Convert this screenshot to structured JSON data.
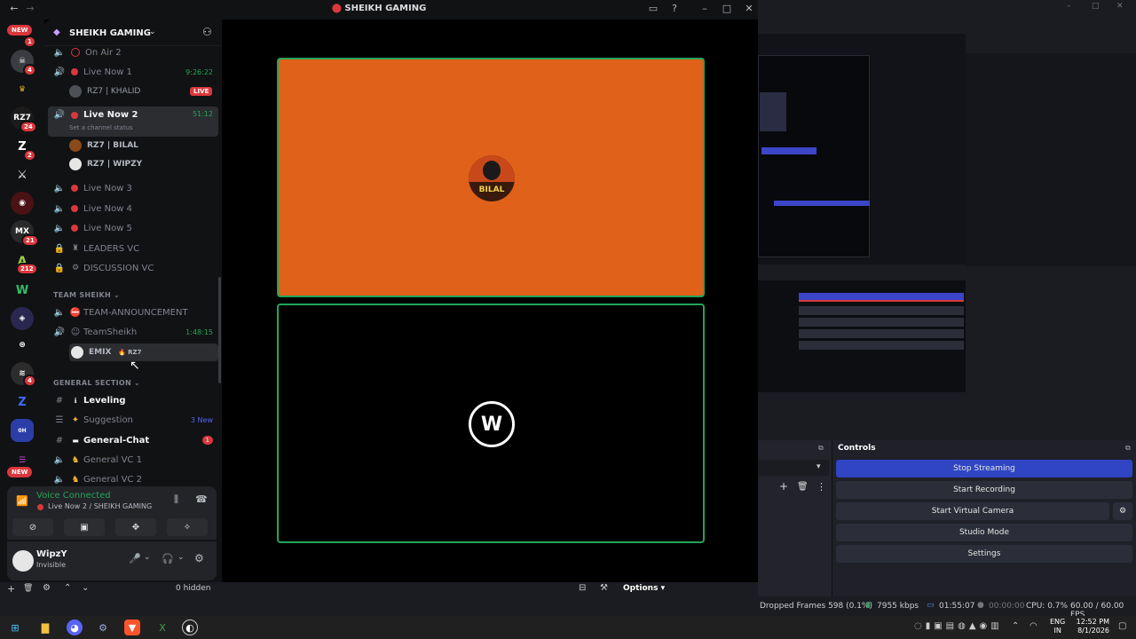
{
  "discord": {
    "window_title": "SHEIKH GAMING",
    "server_name": "SHEIKH GAMING",
    "rail_badges": {
      "new_top": "NEW",
      "b1": "1",
      "b2": "4",
      "b3": "24",
      "b4": "2",
      "b5": "21",
      "b6": "212",
      "b7": "4",
      "new_bottom": "NEW"
    },
    "channels": [
      {
        "label": "On Air 2"
      },
      {
        "label": "Live Now 1",
        "right": "9:26:22"
      },
      {
        "label": "Live Now 2",
        "right": "51:12",
        "status": "Set a channel status"
      },
      {
        "label": "Live Now 3"
      },
      {
        "label": "Live Now 4"
      },
      {
        "label": "Live Now 5"
      },
      {
        "label": "LEADERS VC"
      },
      {
        "label": "DISCUSSION VC"
      }
    ],
    "members": [
      {
        "name": "RZ7 | KHALID",
        "badge": "LIVE"
      },
      {
        "name": "RZ7 | BILAL"
      },
      {
        "name": "RZ7 | WIPZY"
      },
      {
        "name": "EMIX",
        "tag": "RZ7"
      }
    ],
    "cat_team": "TEAM SHEIKH",
    "team_channels": [
      {
        "label": "TEAM-ANNOUNCEMENT"
      },
      {
        "label": "TeamSheikh",
        "right": "1:48:15"
      }
    ],
    "cat_general": "GENERAL SECTION",
    "general_channels": [
      {
        "label": "Leveling"
      },
      {
        "label": "Suggestion",
        "right": "3 New"
      },
      {
        "label": "General-Chat",
        "right": "1"
      },
      {
        "label": "General VC 1"
      },
      {
        "label": "General VC 2"
      }
    ],
    "voice": {
      "title": "Voice Connected",
      "sub": "Live Now 2 / SHEIKH GAMING"
    },
    "user": {
      "name": "WipzY",
      "status": "Invisible"
    },
    "stage_tile_top_label": "BILAL"
  },
  "obs": {
    "controls_title": "Controls",
    "buttons": [
      "Stop Streaming",
      "Start Recording",
      "Start Virtual Camera",
      "Studio Mode",
      "Settings"
    ],
    "hidden": "0 hidden",
    "options": "Options",
    "status": {
      "dropped": "Dropped Frames 598 (0.1%)",
      "kbps": "7955 kbps",
      "stream_time": "01:55:07",
      "rec_time": "00:00:00",
      "cpu": "CPU: 0.7%",
      "fps": "60.00 / 60.00 FPS"
    }
  },
  "taskbar": {
    "lang1": "ENG",
    "lang2": "IN",
    "time": "12:52 PM",
    "date": "8/1/2026"
  },
  "colors": {
    "accent": "#2f45c4",
    "orange": "#e06119",
    "green": "#23a559",
    "red": "#da373c"
  }
}
